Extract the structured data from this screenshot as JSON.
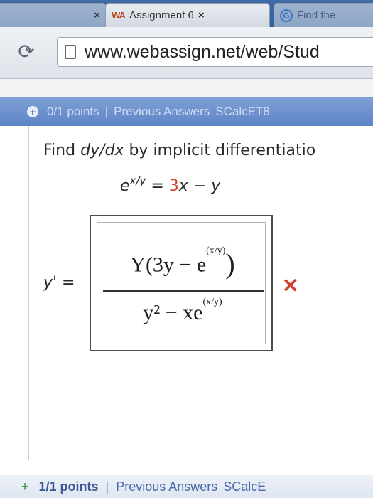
{
  "browser": {
    "tabs": [
      {
        "label": "",
        "state": "inactive"
      },
      {
        "label": "Assignment 6",
        "favicon": "WA",
        "state": "active"
      },
      {
        "label": "Find the",
        "favicon": "G",
        "state": "inactive"
      }
    ],
    "url": "www.webassign.net/web/Stud"
  },
  "question_header": {
    "points": "0/1 points",
    "separator": "|",
    "previous_answers": "Previous Answers",
    "source": "SCalcET8"
  },
  "question": {
    "prompt_prefix": "Find ",
    "prompt_dydx": "dy/dx",
    "prompt_suffix": " by implicit differentiatio",
    "eq_base": "e",
    "eq_exponent": "x/y",
    "eq_equals": " = ",
    "eq_coef": "3",
    "eq_rest_x": "x",
    "eq_minus": " − ",
    "eq_y": "y",
    "answer_label": "y' =",
    "answer_numerator_a": "Y(3y − e",
    "answer_numerator_frac": "(x/y)",
    "answer_numerator_close": ")",
    "answer_denominator_a": "y² − xe",
    "answer_denominator_frac": "(x/y)",
    "result_mark": "✕",
    "result_color": "#d2402f"
  },
  "next_question_header": {
    "points": "1/1 points",
    "separator": "|",
    "previous_answers": "Previous Answers",
    "source": "SCalcE"
  },
  "colors": {
    "header_bar": "#6a8fcf",
    "accent_red": "#c8442f",
    "link_blue": "#4968a8"
  }
}
